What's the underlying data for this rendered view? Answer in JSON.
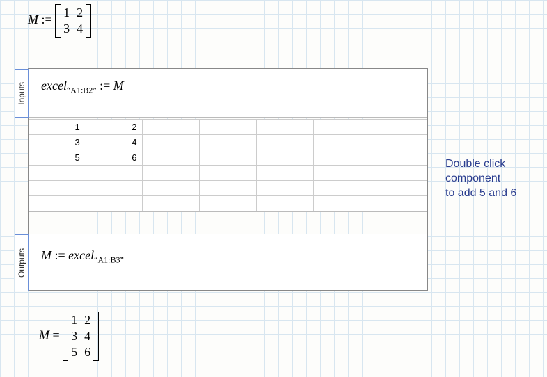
{
  "top_def": {
    "var": "M",
    "op": ":=",
    "matrix": [
      [
        "1",
        "2"
      ],
      [
        "3",
        "4"
      ]
    ]
  },
  "inputs": {
    "tab_label": "Inputs",
    "lhs_var": "excel",
    "lhs_sub": "“A1:B2”",
    "op": ":=",
    "rhs": "M"
  },
  "table": {
    "rows": 6,
    "cols": 7,
    "cells": [
      [
        "1",
        "2",
        "",
        "",
        "",
        "",
        ""
      ],
      [
        "3",
        "4",
        "",
        "",
        "",
        "",
        ""
      ],
      [
        "5",
        "6",
        "",
        "",
        "",
        "",
        ""
      ],
      [
        "",
        "",
        "",
        "",
        "",
        "",
        ""
      ],
      [
        "",
        "",
        "",
        "",
        "",
        "",
        ""
      ],
      [
        "",
        "",
        "",
        "",
        "",
        "",
        ""
      ]
    ]
  },
  "outputs": {
    "tab_label": "Outputs",
    "lhs": "M",
    "op": ":=",
    "rhs_var": "excel",
    "rhs_sub": "“A1:B3”"
  },
  "annotation": {
    "line1": "Double click",
    "line2": "component",
    "line3": "to add 5 and 6"
  },
  "bottom_eval": {
    "var": "M",
    "op": "=",
    "matrix": [
      [
        "1",
        "2"
      ],
      [
        "3",
        "4"
      ],
      [
        "5",
        "6"
      ]
    ]
  }
}
